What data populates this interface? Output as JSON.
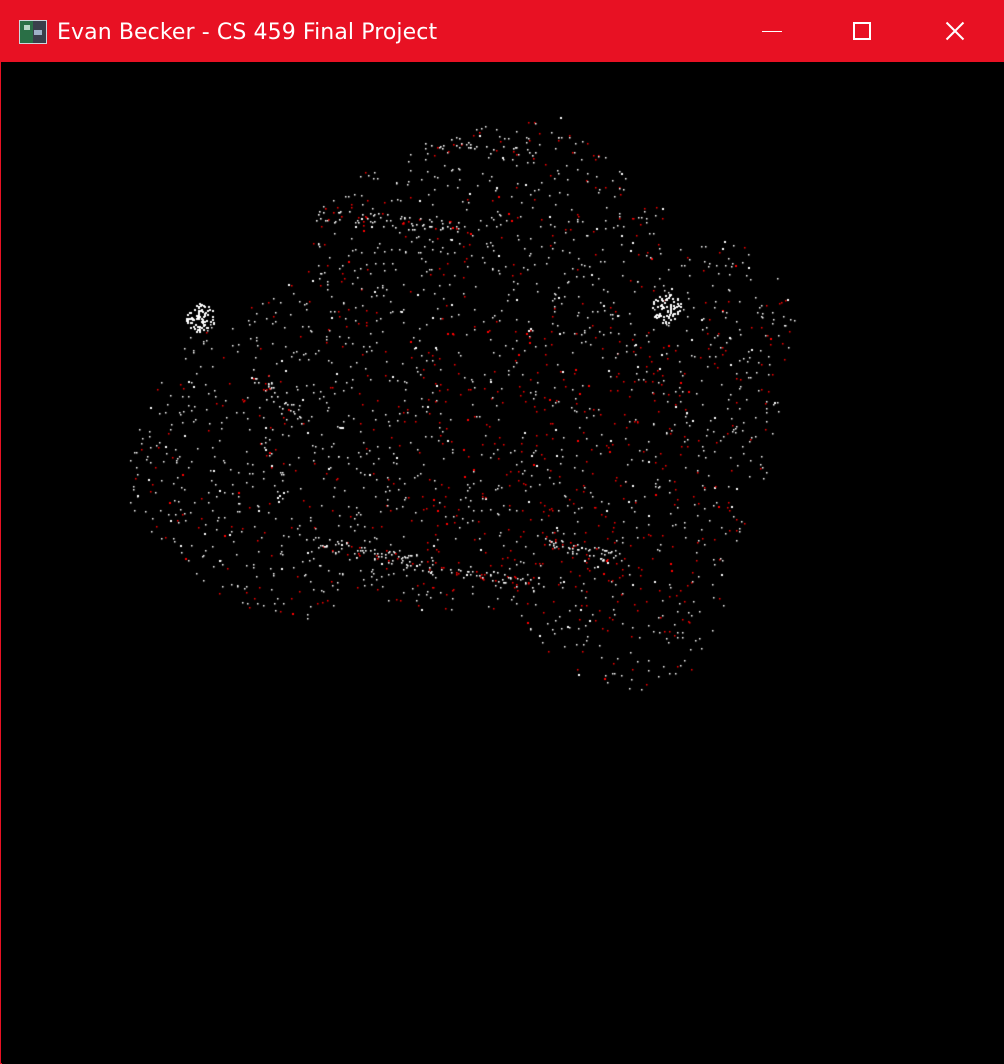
{
  "window": {
    "title": "Evan Becker - CS 459 Final Project",
    "accent_color": "#e81123",
    "background_color": "#000000"
  },
  "titlebar": {
    "app_icon": "program-icon",
    "buttons": [
      {
        "name": "minimize",
        "icon": "minimize-icon"
      },
      {
        "name": "maximize",
        "icon": "maximize-icon"
      },
      {
        "name": "close",
        "icon": "close-icon"
      }
    ]
  },
  "viewport": {
    "content": "point-cloud-rendering",
    "point_colors": [
      "#ffffff",
      "#ff0000"
    ]
  }
}
